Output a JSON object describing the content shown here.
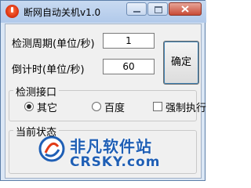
{
  "window": {
    "title": "断网自动关机v1.0"
  },
  "form": {
    "interval_label": "检测周期(单位/秒)",
    "interval_value": "1",
    "countdown_label": "倒计时(单位/秒)",
    "countdown_value": "60",
    "confirm_button": "确定"
  },
  "interface_group": {
    "title": "检测接口",
    "options": [
      {
        "label": "其它",
        "checked": true
      },
      {
        "label": "百度",
        "checked": false
      }
    ],
    "force_label": "强制执行",
    "force_checked": false
  },
  "status_group": {
    "title": "当前状态"
  },
  "watermark": {
    "name": "非凡软件站",
    "url": "CRSKY.com"
  },
  "colors": {
    "title_bar": "#b9cfee",
    "close_button": "#c84b36",
    "watermark": "#1f5fb5"
  }
}
